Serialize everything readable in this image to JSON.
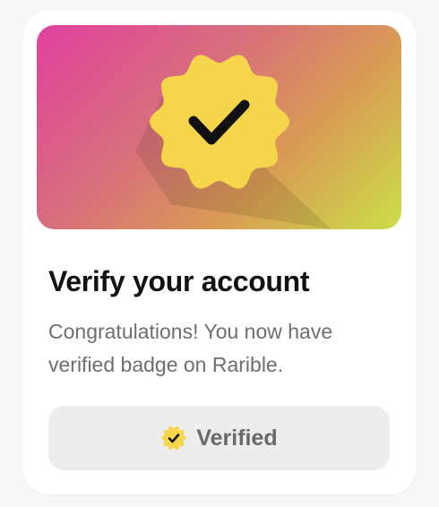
{
  "card": {
    "title": "Verify your account",
    "description": "Congratulations! You now have verified badge on Rarible.",
    "button_label": "Verified"
  },
  "icons": {
    "banner_badge": "verified-badge-icon",
    "button_badge": "verified-badge-icon"
  },
  "colors": {
    "badge_yellow": "#f6d54a",
    "check": "#111111",
    "gradient_start": "#e0409e",
    "gradient_end": "#cbde48",
    "button_bg": "#ededed",
    "button_text": "#6a6a6a",
    "title": "#121212",
    "description": "#6e6e6e"
  }
}
